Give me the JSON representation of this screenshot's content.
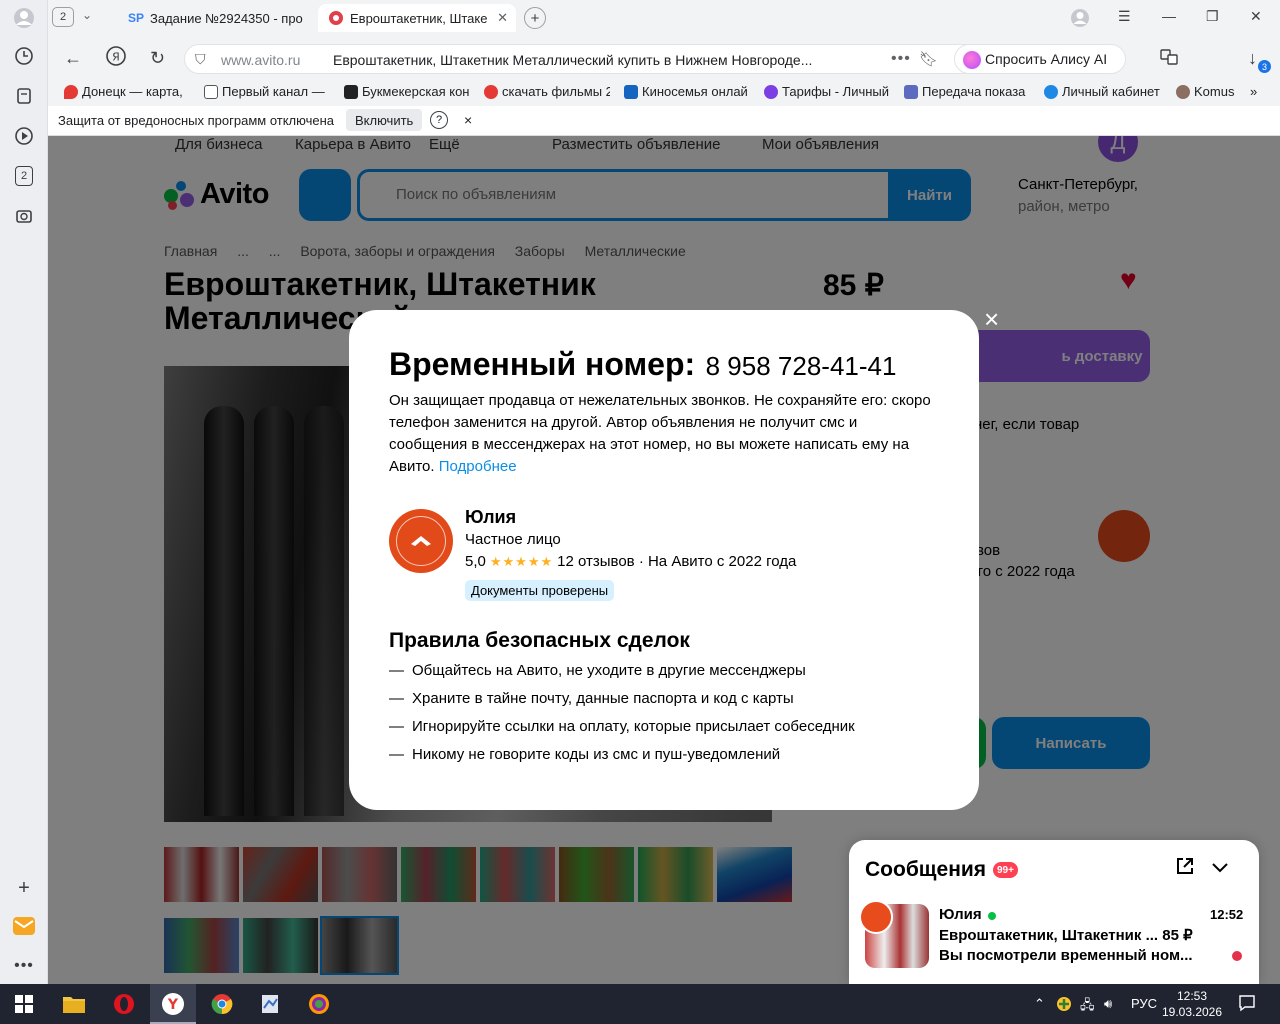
{
  "browser": {
    "tab_count": "2",
    "tabs": [
      {
        "label": "Задание №2924350 - про",
        "icon": "SP"
      },
      {
        "label": "Евроштакетник, Штаке",
        "icon": "avito-icon"
      }
    ],
    "address": {
      "domain": "www.avito.ru",
      "title": "Евроштакетник, Штакетник Металлический купить в Нижнем Новгороде..."
    },
    "alice_label": "Спросить Алису AI",
    "downloads_count": "3",
    "bookmarks": [
      "Донецк — карта, с",
      "Первый канал — с",
      "Букмекерская кон",
      "скачать фильмы 2",
      "Киносемья онлай",
      "Тарифы - Личный",
      "Передача показа",
      "Личный кабинет",
      "Komus"
    ],
    "infobar": {
      "message": "Защита от вредоносных программ отключена",
      "enable_label": "Включить",
      "help": "?",
      "close": "×"
    }
  },
  "page": {
    "top_links": [
      "Для бизнеса",
      "Карьера в Авито",
      "Ещё"
    ],
    "post_ad": "Разместить объявление",
    "my_ads": "Мои объявления",
    "user_initial": "Д",
    "logo_text": "Avito",
    "search_placeholder": "Поиск по объявлениям",
    "search_button": "Найти",
    "city": "Санкт-Петербург,",
    "city_sub": "район, метро",
    "breadcrumbs": [
      "Главная",
      "...",
      "...",
      "Ворота, заборы и ограждения",
      "Заборы",
      "Металлические"
    ],
    "title": "Евроштакетник, Штакетник Металлический",
    "price": "85 ₽",
    "delivery_button": "ь доставку",
    "side_text_1": "нег, если товар",
    "side_text_2": "вов",
    "side_text_3": "то с 2022 года",
    "write_button": "Написать"
  },
  "modal": {
    "heading": "Временный номер:",
    "phone": "8 958 728-41-41",
    "description": "Он защищает продавца от нежелательных звонков. Не сохраняйте его: скоро телефон заменится на другой. Автор объявления не получит смс и сообщения в мессенджерах на этот номер, но вы можете написать ему на Авито.",
    "more_link": "Подробнее",
    "close": "×",
    "seller": {
      "name": "Юлия",
      "type": "Частное лицо",
      "rating": "5,0",
      "stars": "★★★★★",
      "reviews": "12 отзывов · На Авито с 2022 года",
      "badge": "Документы проверены"
    },
    "rules_title": "Правила безопасных сделок",
    "rules": [
      "Общайтесь на Авито, не уходите в другие мессенджеры",
      "Храните в тайне почту, данные паспорта и код с карты",
      "Игнорируйте ссылки на оплату, которые присылает собеседник",
      "Никому не говорите коды из смс и пуш-уведомлений"
    ]
  },
  "messages": {
    "title": "Сообщения",
    "badge": "99+",
    "chat": {
      "name": "Юлия",
      "time": "12:52",
      "subject": "Евроштакетник, Штакетник ... 85 ₽",
      "preview": "Вы посмотрели временный ном..."
    }
  },
  "taskbar": {
    "lang": "РУС",
    "time": "12:53",
    "date": "19.03.2026"
  },
  "colors": {
    "avito_blue": "#0a8ee8",
    "avito_purple": "#965eeb",
    "avito_green": "#04c045",
    "heart_red": "#e3002a"
  }
}
